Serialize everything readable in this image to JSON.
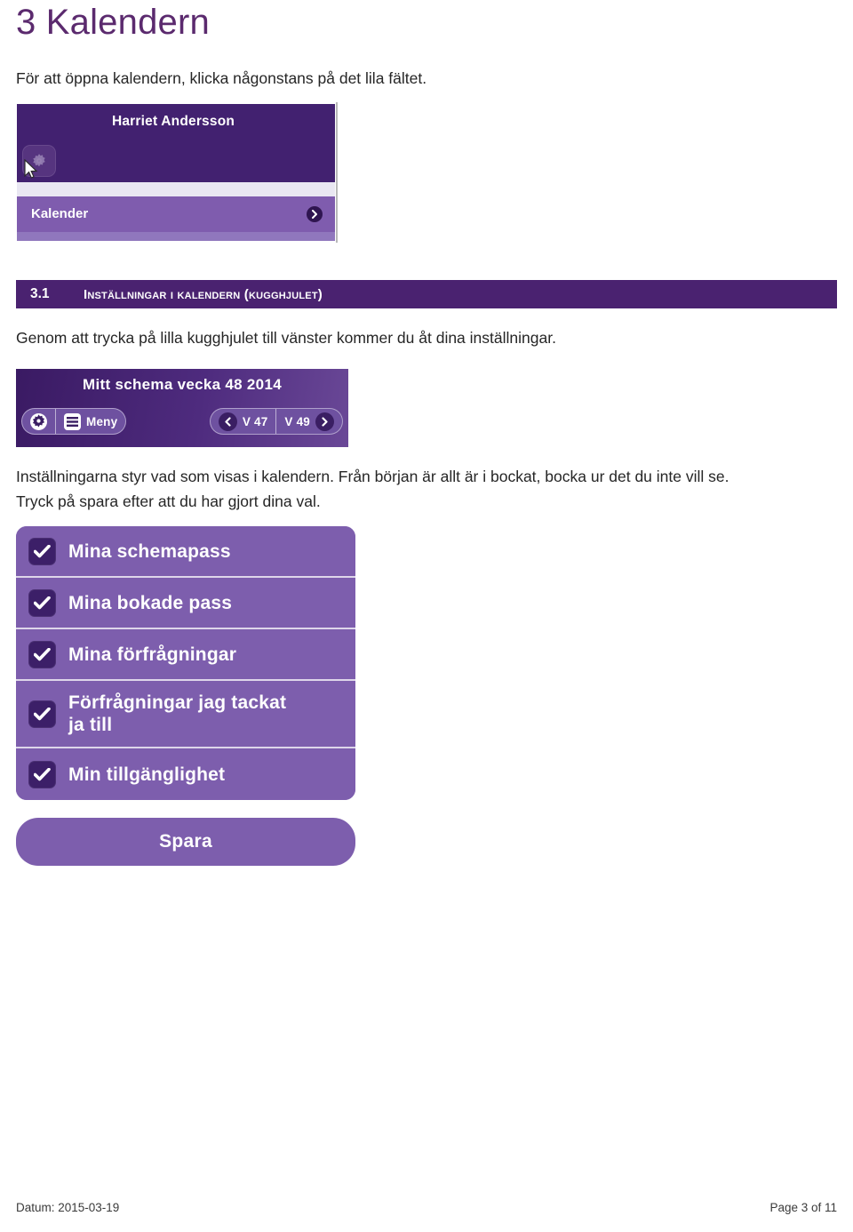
{
  "document": {
    "title": "3 Kalendern",
    "intro": "För att öppna kalendern, klicka någonstans på det lila fältet."
  },
  "colors": {
    "heading_purple": "#5b2a6e",
    "section_bar": "#4a2270",
    "app_header_dark": "#422170",
    "app_row_purple": "#7f5cae",
    "checkbox_dark": "#3c1f68",
    "list_row_purple": "#7d5ead"
  },
  "screenshot_menu": {
    "name": "Harriet Andersson",
    "gear_icon": "gear-icon",
    "cursor_icon": "mouse-cursor-icon",
    "row_label": "Kalender",
    "row_chevron_icon": "chevron-right-icon"
  },
  "section": {
    "number": "3.1",
    "title": "Inställningar i kalendern (kugghjulet)",
    "paragraph": "Genom att trycka på lilla kugghjulet till vänster kommer du åt dina inställningar."
  },
  "screenshot_schema": {
    "title": "Mitt schema vecka 48  2014",
    "gear_icon": "gear-icon",
    "menu_icon": "hamburger-menu-icon",
    "menu_label": "Meny",
    "prev_icon": "chevron-left-icon",
    "prev_label": "V 47",
    "next_label": "V 49",
    "next_icon": "chevron-right-icon"
  },
  "body": {
    "paragraph_line1": "Inställningarna styr vad som visas i kalendern. Från början är allt är i bockat, bocka ur det du inte  vill se.",
    "paragraph_line2": "Tryck på spara efter att du har gjort dina val."
  },
  "screenshot_settings": {
    "items": [
      {
        "label": "Mina schemapass",
        "checked": true,
        "two_line": false
      },
      {
        "label": "Mina bokade pass",
        "checked": true,
        "two_line": false
      },
      {
        "label": "Mina förfrågningar",
        "checked": true,
        "two_line": false
      },
      {
        "label": "Förfrågningar jag tackat ja till",
        "checked": true,
        "two_line": true
      },
      {
        "label": "Min tillgänglighet",
        "checked": true,
        "two_line": false
      }
    ],
    "save_label": "Spara",
    "check_icon": "checkmark-icon"
  },
  "footer": {
    "date": "Datum: 2015-03-19",
    "page": "Page 3 of 11"
  }
}
